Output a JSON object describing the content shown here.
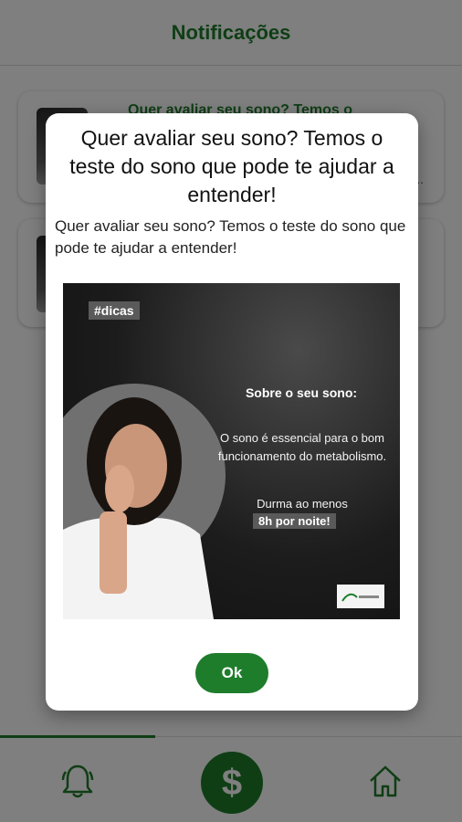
{
  "header": {
    "title": "Notificações"
  },
  "notifications": [
    {
      "title": "Quer avaliar seu sono? Temos o",
      "more": "..."
    },
    {
      "title": "",
      "more": ""
    }
  ],
  "modal": {
    "title": "Quer avaliar seu sono? Temos o teste do sono que pode te ajudar a entender!",
    "body": "Quer avaliar seu sono? Temos o teste do sono que pode te ajudar a entender!",
    "image": {
      "tag": "#dicas",
      "heading": "Sobre o seu sono:",
      "text": "O sono é essencial para o bom funcionamento do metabolismo.",
      "text2": "Durma ao menos",
      "highlight": "8h por noite!"
    },
    "ok_label": "Ok"
  },
  "bottom_nav": {
    "money_symbol": "$",
    "icons": [
      "bell-icon",
      "money-icon",
      "home-icon"
    ]
  },
  "colors": {
    "brand_green": "#1e7d2b",
    "overlay": "rgba(0,0,0,0.5)"
  }
}
